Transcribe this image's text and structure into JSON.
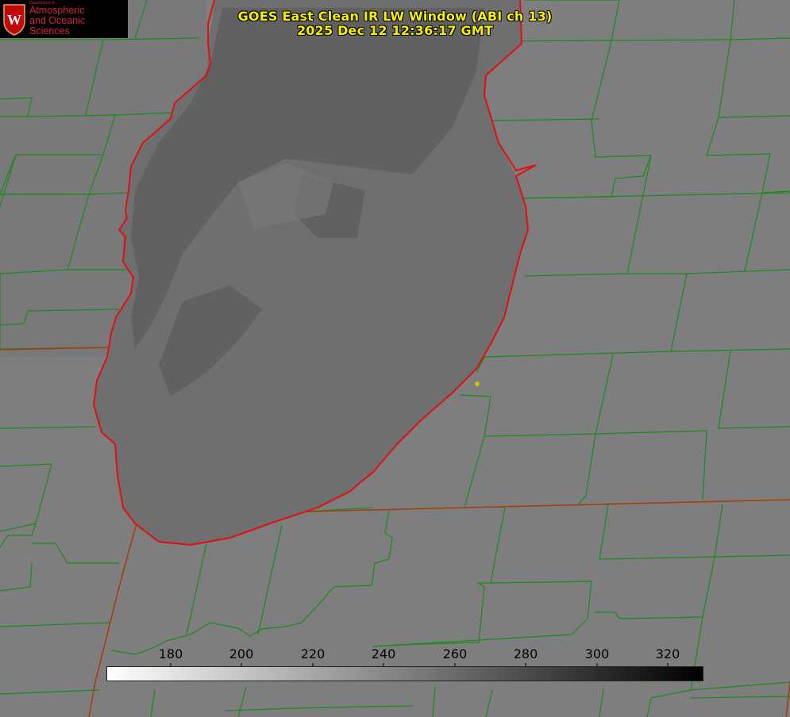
{
  "title": {
    "line1": "GOES East Clean IR LW Window (ABI ch 13)",
    "line2": "2025 Dec 12 12:36:17 GMT"
  },
  "logo": {
    "dept": "Department of",
    "line1": "Atmospheric",
    "line2": "and Oceanic Sciences"
  },
  "colorbar": {
    "ticks": [
      "180",
      "200",
      "220",
      "240",
      "260",
      "280",
      "300",
      "320"
    ],
    "min_value": 163,
    "max_value": 331,
    "colormap": "white-to-black"
  },
  "colors": {
    "county_lines": "#1a8a1a",
    "lake_shoreline": "#e01010",
    "state_border": "#a04010",
    "title_text": "#f5f000",
    "city_marker": "#d6c000",
    "logo_text": "#d9233b"
  }
}
